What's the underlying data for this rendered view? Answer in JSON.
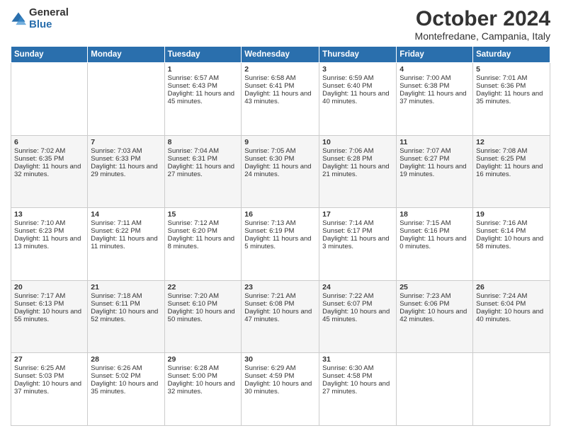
{
  "header": {
    "logo_line1": "General",
    "logo_line2": "Blue",
    "month": "October 2024",
    "location": "Montefredane, Campania, Italy"
  },
  "weekdays": [
    "Sunday",
    "Monday",
    "Tuesday",
    "Wednesday",
    "Thursday",
    "Friday",
    "Saturday"
  ],
  "weeks": [
    [
      {
        "day": "",
        "info": ""
      },
      {
        "day": "",
        "info": ""
      },
      {
        "day": "1",
        "info": "Sunrise: 6:57 AM\nSunset: 6:43 PM\nDaylight: 11 hours and 45 minutes."
      },
      {
        "day": "2",
        "info": "Sunrise: 6:58 AM\nSunset: 6:41 PM\nDaylight: 11 hours and 43 minutes."
      },
      {
        "day": "3",
        "info": "Sunrise: 6:59 AM\nSunset: 6:40 PM\nDaylight: 11 hours and 40 minutes."
      },
      {
        "day": "4",
        "info": "Sunrise: 7:00 AM\nSunset: 6:38 PM\nDaylight: 11 hours and 37 minutes."
      },
      {
        "day": "5",
        "info": "Sunrise: 7:01 AM\nSunset: 6:36 PM\nDaylight: 11 hours and 35 minutes."
      }
    ],
    [
      {
        "day": "6",
        "info": "Sunrise: 7:02 AM\nSunset: 6:35 PM\nDaylight: 11 hours and 32 minutes."
      },
      {
        "day": "7",
        "info": "Sunrise: 7:03 AM\nSunset: 6:33 PM\nDaylight: 11 hours and 29 minutes."
      },
      {
        "day": "8",
        "info": "Sunrise: 7:04 AM\nSunset: 6:31 PM\nDaylight: 11 hours and 27 minutes."
      },
      {
        "day": "9",
        "info": "Sunrise: 7:05 AM\nSunset: 6:30 PM\nDaylight: 11 hours and 24 minutes."
      },
      {
        "day": "10",
        "info": "Sunrise: 7:06 AM\nSunset: 6:28 PM\nDaylight: 11 hours and 21 minutes."
      },
      {
        "day": "11",
        "info": "Sunrise: 7:07 AM\nSunset: 6:27 PM\nDaylight: 11 hours and 19 minutes."
      },
      {
        "day": "12",
        "info": "Sunrise: 7:08 AM\nSunset: 6:25 PM\nDaylight: 11 hours and 16 minutes."
      }
    ],
    [
      {
        "day": "13",
        "info": "Sunrise: 7:10 AM\nSunset: 6:23 PM\nDaylight: 11 hours and 13 minutes."
      },
      {
        "day": "14",
        "info": "Sunrise: 7:11 AM\nSunset: 6:22 PM\nDaylight: 11 hours and 11 minutes."
      },
      {
        "day": "15",
        "info": "Sunrise: 7:12 AM\nSunset: 6:20 PM\nDaylight: 11 hours and 8 minutes."
      },
      {
        "day": "16",
        "info": "Sunrise: 7:13 AM\nSunset: 6:19 PM\nDaylight: 11 hours and 5 minutes."
      },
      {
        "day": "17",
        "info": "Sunrise: 7:14 AM\nSunset: 6:17 PM\nDaylight: 11 hours and 3 minutes."
      },
      {
        "day": "18",
        "info": "Sunrise: 7:15 AM\nSunset: 6:16 PM\nDaylight: 11 hours and 0 minutes."
      },
      {
        "day": "19",
        "info": "Sunrise: 7:16 AM\nSunset: 6:14 PM\nDaylight: 10 hours and 58 minutes."
      }
    ],
    [
      {
        "day": "20",
        "info": "Sunrise: 7:17 AM\nSunset: 6:13 PM\nDaylight: 10 hours and 55 minutes."
      },
      {
        "day": "21",
        "info": "Sunrise: 7:18 AM\nSunset: 6:11 PM\nDaylight: 10 hours and 52 minutes."
      },
      {
        "day": "22",
        "info": "Sunrise: 7:20 AM\nSunset: 6:10 PM\nDaylight: 10 hours and 50 minutes."
      },
      {
        "day": "23",
        "info": "Sunrise: 7:21 AM\nSunset: 6:08 PM\nDaylight: 10 hours and 47 minutes."
      },
      {
        "day": "24",
        "info": "Sunrise: 7:22 AM\nSunset: 6:07 PM\nDaylight: 10 hours and 45 minutes."
      },
      {
        "day": "25",
        "info": "Sunrise: 7:23 AM\nSunset: 6:06 PM\nDaylight: 10 hours and 42 minutes."
      },
      {
        "day": "26",
        "info": "Sunrise: 7:24 AM\nSunset: 6:04 PM\nDaylight: 10 hours and 40 minutes."
      }
    ],
    [
      {
        "day": "27",
        "info": "Sunrise: 6:25 AM\nSunset: 5:03 PM\nDaylight: 10 hours and 37 minutes."
      },
      {
        "day": "28",
        "info": "Sunrise: 6:26 AM\nSunset: 5:02 PM\nDaylight: 10 hours and 35 minutes."
      },
      {
        "day": "29",
        "info": "Sunrise: 6:28 AM\nSunset: 5:00 PM\nDaylight: 10 hours and 32 minutes."
      },
      {
        "day": "30",
        "info": "Sunrise: 6:29 AM\nSunset: 4:59 PM\nDaylight: 10 hours and 30 minutes."
      },
      {
        "day": "31",
        "info": "Sunrise: 6:30 AM\nSunset: 4:58 PM\nDaylight: 10 hours and 27 minutes."
      },
      {
        "day": "",
        "info": ""
      },
      {
        "day": "",
        "info": ""
      }
    ]
  ]
}
